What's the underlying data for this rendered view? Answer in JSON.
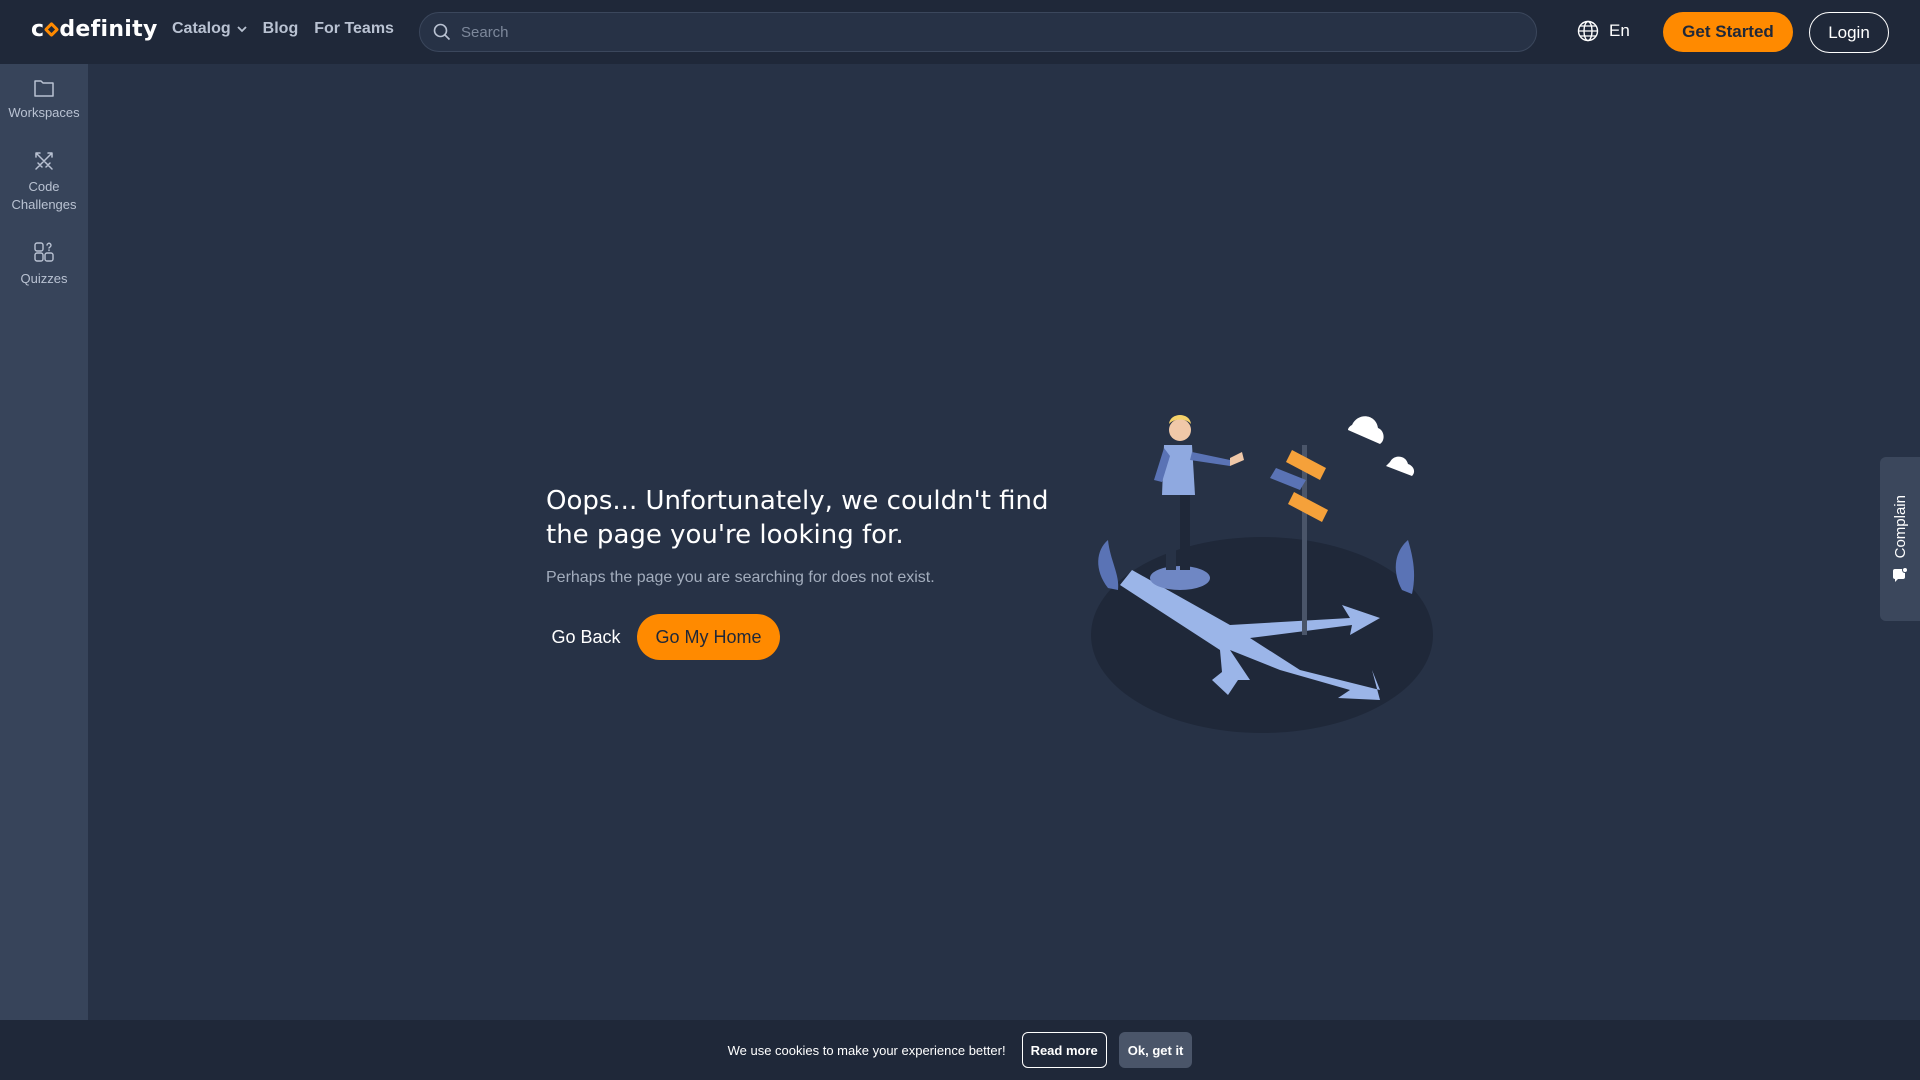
{
  "header": {
    "logo_text_pre": "c",
    "logo_text_post": "definity",
    "nav": {
      "catalog": "Catalog",
      "blog": "Blog",
      "for_teams": "For Teams"
    },
    "search": {
      "placeholder": "Search",
      "value": ""
    },
    "language": "En",
    "get_started": "Get Started",
    "login": "Login"
  },
  "sidebar": {
    "items": [
      {
        "label": "Workspaces",
        "icon": "folder-icon"
      },
      {
        "label": "Code\nChallenges",
        "icon": "swords-icon"
      },
      {
        "label": "Quizzes",
        "icon": "puzzle-icon"
      }
    ]
  },
  "main": {
    "headline": "Oops... Unfortunately, we couldn't find the page you're looking for.",
    "subline": "Perhaps the page you are searching for does not exist.",
    "go_back": "Go Back",
    "go_home": "Go My Home"
  },
  "complain": {
    "label": "Complain"
  },
  "cookie": {
    "message": "We use cookies to make your experience better!",
    "read_more": "Read more",
    "ok": "Ok, get it"
  },
  "colors": {
    "accent": "#ff8a00",
    "background": "#273246",
    "header": "#1f2839",
    "sidebar": "#37445a"
  }
}
